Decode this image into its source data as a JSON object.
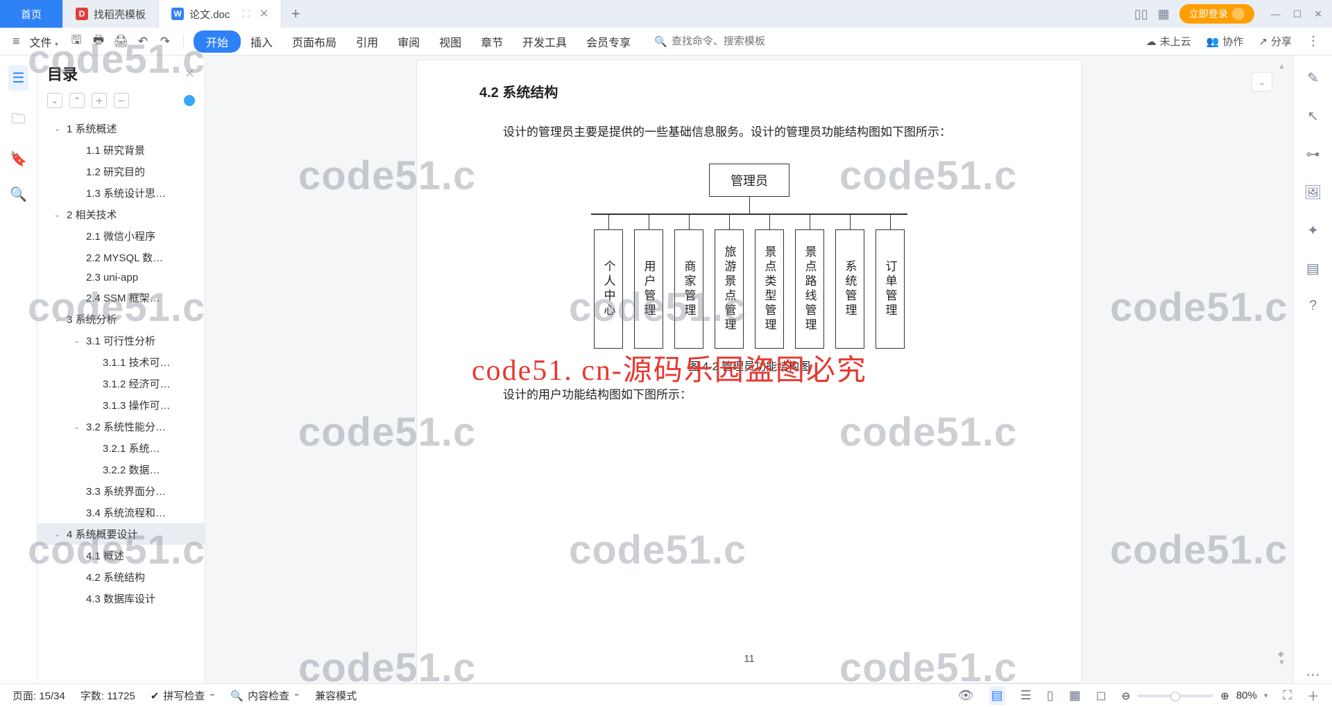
{
  "tabs": {
    "home": "首页",
    "t1": "找稻壳模板",
    "t2": "论文.doc",
    "plus": "+"
  },
  "topRight": {
    "login": "立即登录"
  },
  "ribbon": {
    "file": "文件",
    "menus": [
      "开始",
      "插入",
      "页面布局",
      "引用",
      "审阅",
      "视图",
      "章节",
      "开发工具",
      "会员专享"
    ],
    "searchPlaceholder": "查找命令、搜索模板",
    "cloud": "未上云",
    "collab": "协作",
    "share": "分享"
  },
  "outline": {
    "title": "目录",
    "items": [
      {
        "t": "1 系统概述",
        "lv": 1,
        "c": true
      },
      {
        "t": "1.1 研究背景",
        "lv": 2
      },
      {
        "t": "1.2 研究目的",
        "lv": 2
      },
      {
        "t": "1.3 系统设计思…",
        "lv": 2
      },
      {
        "t": "2 相关技术",
        "lv": 1,
        "c": true
      },
      {
        "t": "2.1 微信小程序",
        "lv": 2
      },
      {
        "t": "2.2 MYSQL 数…",
        "lv": 2
      },
      {
        "t": "2.3 uni-app",
        "lv": 2
      },
      {
        "t": "2.4 SSM 框架…",
        "lv": 2
      },
      {
        "t": "3 系统分析",
        "lv": 1,
        "c": true
      },
      {
        "t": "3.1 可行性分析",
        "lv": 2,
        "c": true
      },
      {
        "t": "3.1.1 技术可…",
        "lv": 3
      },
      {
        "t": "3.1.2 经济可…",
        "lv": 3
      },
      {
        "t": "3.1.3 操作可…",
        "lv": 3
      },
      {
        "t": "3.2 系统性能分…",
        "lv": 2,
        "c": true
      },
      {
        "t": "3.2.1  系统…",
        "lv": 3
      },
      {
        "t": "3.2.2  数据…",
        "lv": 3
      },
      {
        "t": "3.3 系统界面分…",
        "lv": 2
      },
      {
        "t": "3.4 系统流程和…",
        "lv": 2
      },
      {
        "t": "4 系统概要设计",
        "lv": 1,
        "c": true,
        "sel": true
      },
      {
        "t": "4.1 概述",
        "lv": 2
      },
      {
        "t": "4.2 系统结构",
        "lv": 2
      },
      {
        "t": "4.3 数据库设计",
        "lv": 2
      }
    ]
  },
  "doc": {
    "heading": "4.2 系统结构",
    "para1": "设计的管理员主要是提供的一些基础信息服务。设计的管理员功能结构图如下图所示：",
    "root": "管理员",
    "children": [
      "个人中心",
      "用户管理",
      "商家管理",
      "旅游景点管理",
      "景点类型管理",
      "景点路线管理",
      "系统管理",
      "订单管理"
    ],
    "caption": "图 4-2 管理员功能结构图",
    "para2": "设计的用户功能结构图如下图所示：",
    "pageNum": "11"
  },
  "watermark": {
    "grey": "code51.c",
    "red": "code51. cn-源码乐园盗图必究"
  },
  "status": {
    "page": "页面: 15/34",
    "words": "字数: 11725",
    "spell": "拼写检查",
    "content": "内容检查",
    "compat": "兼容模式",
    "zoom": "80%"
  }
}
